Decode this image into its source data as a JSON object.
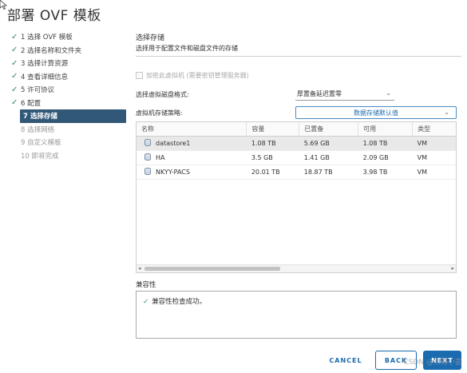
{
  "title": "部署 OVF 模板",
  "steps": [
    {
      "label": "1 选择 OVF 模板",
      "state": "done"
    },
    {
      "label": "2 选择名称和文件夹",
      "state": "done"
    },
    {
      "label": "3 选择计算资源",
      "state": "done"
    },
    {
      "label": "4 查看详细信息",
      "state": "done"
    },
    {
      "label": "5 许可协议",
      "state": "done"
    },
    {
      "label": "6 配置",
      "state": "done"
    },
    {
      "label": "7 选择存储",
      "state": "active"
    },
    {
      "label": "8 选择网络",
      "state": "pending"
    },
    {
      "label": "9 自定义模板",
      "state": "pending"
    },
    {
      "label": "10 即将完成",
      "state": "pending"
    }
  ],
  "section": {
    "title": "选择存储",
    "subtitle": "选择用于配置文件和磁盘文件的存储"
  },
  "encrypt_label": "加密此虚拟机 (需要密钥管理服务器)",
  "disk_format": {
    "label": "选择虚拟磁盘格式:",
    "value": "厚置备延迟置零"
  },
  "storage_policy": {
    "label": "虚拟机存储策略:",
    "value": "数据存储默认值"
  },
  "table": {
    "headers": [
      "名称",
      "容量",
      "已置备",
      "可用",
      "类型"
    ],
    "rows": [
      {
        "name": "datastore1",
        "capacity": "1.08 TB",
        "provisioned": "5.69 GB",
        "free": "1.08 TB",
        "type": "VM"
      },
      {
        "name": "HA",
        "capacity": "3.5 GB",
        "provisioned": "1.41 GB",
        "free": "2.09 GB",
        "type": "VM"
      },
      {
        "name": "NKYY-PACS",
        "capacity": "20.01 TB",
        "provisioned": "18.87 TB",
        "free": "3.98 TB",
        "type": "VM"
      }
    ]
  },
  "compat": {
    "label": "兼容性",
    "message": "兼容性检查成功。"
  },
  "buttons": {
    "cancel": "CANCEL",
    "back": "BACK",
    "next": "NEXT"
  },
  "watermark": "CSDN @杰哥小姜"
}
